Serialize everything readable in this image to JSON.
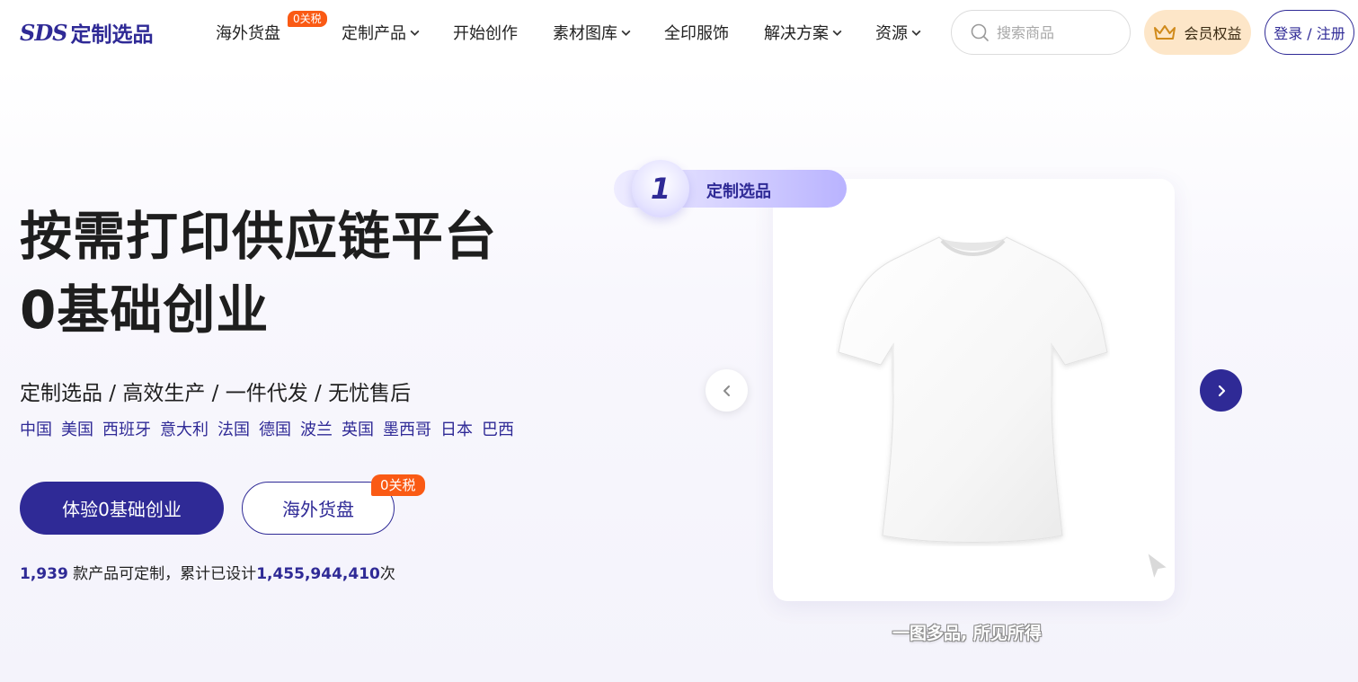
{
  "header": {
    "logo_mark": "SDS",
    "logo_text": "定制选品",
    "nav": [
      {
        "label": "海外货盘",
        "badge": "0关税"
      },
      {
        "label": "定制产品"
      },
      {
        "label": "开始创作"
      },
      {
        "label": "素材图库"
      },
      {
        "label": "全印服饰"
      },
      {
        "label": "解决方案"
      },
      {
        "label": "资源"
      }
    ],
    "search_placeholder": "搜索商品",
    "vip_label": "会员权益",
    "login_label": "登录 / 注册"
  },
  "hero": {
    "title_line1": "按需打印供应链平台",
    "title_line2": "0基础创业",
    "subtitle": "定制选品 / 高效生产 / 一件代发 / 无忧售后",
    "countries": [
      "中国",
      "美国",
      "西班牙",
      "意大利",
      "法国",
      "德国",
      "波兰",
      "英国",
      "墨西哥",
      "日本",
      "巴西"
    ],
    "primary_button": "体验0基础创业",
    "secondary_button": "海外货盘",
    "secondary_badge": "0关税",
    "stats": {
      "product_count": "1,939",
      "product_text": " 款产品可定制，累计已设计",
      "design_count": "1,455,944,410",
      "design_suffix": "次"
    }
  },
  "showcase": {
    "step_number": "1",
    "step_label": "定制选品",
    "caption": "一图多品, 所见所得"
  },
  "colors": {
    "brand": "#2f2a96",
    "badge": "#fa5a14",
    "vip_bg": "#fde6c8"
  }
}
